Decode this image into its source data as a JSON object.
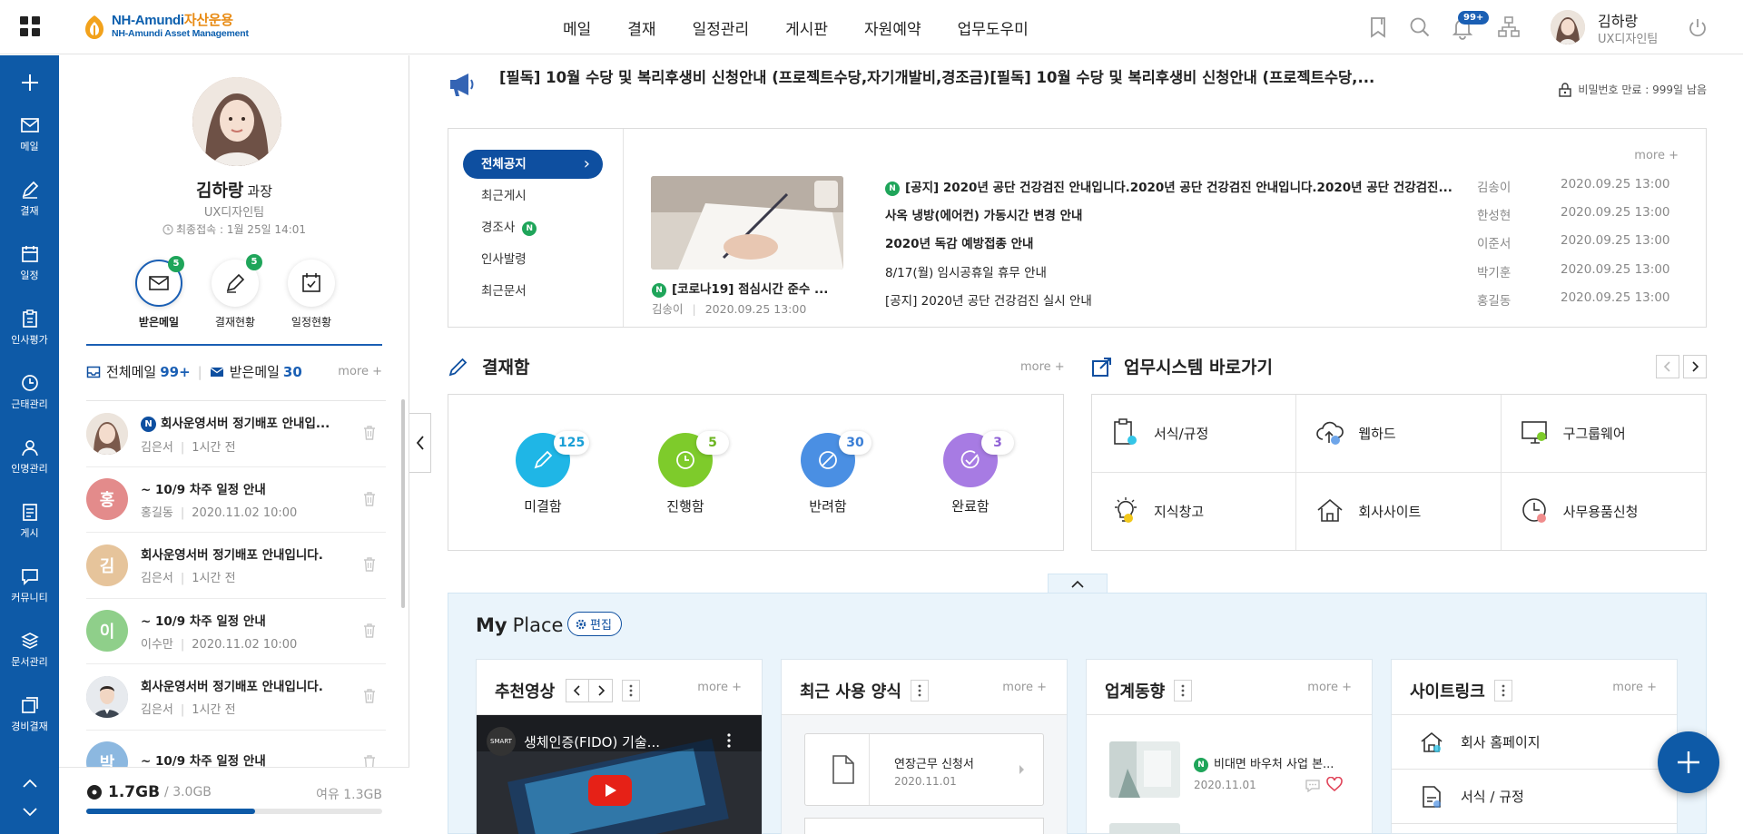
{
  "header": {
    "logo": {
      "brand": "NH-Amundi",
      "brand_kr": "자산운용",
      "sub": "NH-Amundi Asset Management"
    },
    "nav": [
      "메일",
      "결재",
      "일정관리",
      "게시판",
      "자원예약",
      "업무도우미"
    ],
    "notification_badge": "99+",
    "user": {
      "name": "김하랑",
      "dept": "UX디자인팀"
    }
  },
  "rail": [
    {
      "label": "메일",
      "icon": "mail-icon"
    },
    {
      "label": "결재",
      "icon": "pen-icon"
    },
    {
      "label": "일정",
      "icon": "calendar-icon"
    },
    {
      "label": "인사평가",
      "icon": "clipboard-icon"
    },
    {
      "label": "근태관리",
      "icon": "clock-icon"
    },
    {
      "label": "인명관리",
      "icon": "person-icon"
    },
    {
      "label": "게시",
      "icon": "board-icon"
    },
    {
      "label": "커뮤니티",
      "icon": "chat-icon"
    },
    {
      "label": "문서관리",
      "icon": "layers-icon"
    },
    {
      "label": "경비결재",
      "icon": "receipt-icon"
    }
  ],
  "profile": {
    "name": "김하랑",
    "rank": "과장",
    "dept": "UX디자인팀",
    "last_login": "최종접속 : 1월 25일 14:01",
    "quick": [
      {
        "label": "받은메일",
        "badge": "5"
      },
      {
        "label": "결재현황",
        "badge": "5"
      },
      {
        "label": "일정현황",
        "badge": ""
      }
    ],
    "mail_tabs": {
      "all_label": "전체메일",
      "all_count": "99+",
      "inbox_label": "받은메일",
      "inbox_count": "30",
      "more": "more +"
    },
    "mails": [
      {
        "subject": "회사운영서버 정기배포 안내입...",
        "sender": "김은서",
        "time": "1시간 전",
        "avatar": "",
        "color": "#e9ded6",
        "new": true,
        "new_tag": "N"
      },
      {
        "subject": "~ 10/9 차주 일정 안내",
        "sender": "홍길동",
        "time": "2020.11.02 10:00",
        "avatar": "홍",
        "color": "#e38b8b",
        "new": false
      },
      {
        "subject": "회사운영서버 정기배포 안내입니다.",
        "sender": "김은서",
        "time": "1시간 전",
        "avatar": "김",
        "color": "#e6c49b",
        "new": false
      },
      {
        "subject": "~ 10/9 차주 일정 안내",
        "sender": "이수만",
        "time": "2020.11.02 10:00",
        "avatar": "이",
        "color": "#8fcf8a",
        "new": false
      },
      {
        "subject": "회사운영서버 정기배포 안내입니다.",
        "sender": "김은서",
        "time": "1시간 전",
        "avatar": "",
        "color": "#b7bcc4",
        "new": false
      },
      {
        "subject": "~ 10/9 차주 일정 안내",
        "sender": "",
        "time": "",
        "avatar": "박",
        "color": "#8cb8e0",
        "new": false
      }
    ],
    "storage": {
      "used": "1.7GB",
      "total": "/ 3.0GB",
      "free": "여유 1.3GB",
      "ratio": 0.57
    }
  },
  "notice": {
    "text": "[필독] 10월 수당 및 복리후생비 신청안내 (프로젝트수당,자기개발비,경조금)[필독] 10월 수당 및 복리후생비 신청안내 (프로젝트수당,...",
    "password": "비밀번호 만료 : 999일 남음"
  },
  "board": {
    "tabs": [
      "전체공지",
      "최근게시",
      "경조사",
      "인사발령",
      "최근문서"
    ],
    "new_tag": "N",
    "more": "more +",
    "featured": {
      "title": "[코로나19] 점심시간 준수 ...",
      "author": "김송이",
      "date": "2020.09.25 13:00"
    },
    "rows": [
      {
        "title": "[공지] 2020년 공단 건강검진 안내입니다.2020년 공단 건강검진 안내입니다.2020년 공단 건강검진...",
        "author": "김송이",
        "date": "2020.09.25 13:00",
        "bold": true,
        "new": true
      },
      {
        "title": "사옥 냉방(에어컨) 가동시간 변경 안내",
        "author": "한성현",
        "date": "2020.09.25 13:00",
        "bold": true,
        "new": false
      },
      {
        "title": "2020년 독감 예방접종 안내",
        "author": "이준서",
        "date": "2020.09.25 13:00",
        "bold": true,
        "new": false
      },
      {
        "title": "8/17(월) 임시공휴일 휴무 안내",
        "author": "박기훈",
        "date": "2020.09.25 13:00",
        "bold": false,
        "new": false
      },
      {
        "title": "[공지] 2020년 공단 건강검진 실시 안내",
        "author": "홍길동",
        "date": "2020.09.25 13:00",
        "bold": false,
        "new": false
      }
    ]
  },
  "approval": {
    "title": "결재함",
    "more": "more +",
    "items": [
      {
        "label": "미결함",
        "count": "125",
        "color": "#1fb6e6",
        "badge_color": "#1a9fd6"
      },
      {
        "label": "진행함",
        "count": "5",
        "color": "#7ecb2b",
        "badge_color": "#6db523"
      },
      {
        "label": "반려함",
        "count": "30",
        "color": "#4a8fe3",
        "badge_color": "#3b7fd6"
      },
      {
        "label": "완료함",
        "count": "3",
        "color": "#a77be3",
        "badge_color": "#9163d6"
      }
    ]
  },
  "shortcuts": {
    "title": "업무시스템 바로가기",
    "items": [
      {
        "label": "서식/규정",
        "icon": "clipboard-icon"
      },
      {
        "label": "웹하드",
        "icon": "cloud-upload-icon"
      },
      {
        "label": "구그룹웨어",
        "icon": "monitor-icon"
      },
      {
        "label": "지식창고",
        "icon": "bulb-icon"
      },
      {
        "label": "회사사이트",
        "icon": "home-icon"
      },
      {
        "label": "사무용품신청",
        "icon": "clock-icon"
      }
    ]
  },
  "myplace": {
    "title_bold": "My",
    "title_rest": "Place",
    "edit": "편집",
    "cards": {
      "video": {
        "title": "추천영상",
        "more": "more +",
        "video_title": "생체인증(FIDO) 기술..."
      },
      "forms": {
        "title": "최근 사용 양식",
        "more": "more +",
        "item_title": "연장근무 신청서",
        "item_date": "2020.11.01"
      },
      "industry": {
        "title": "업계동향",
        "more": "more +",
        "new_tag": "N",
        "item_title": "비대면 바우처 사업 본...",
        "item_date": "2020.11.01"
      },
      "links": {
        "title": "사이트링크",
        "more": "more +",
        "items": [
          "회사 홈페이지",
          "서식 / 규정"
        ]
      }
    }
  }
}
